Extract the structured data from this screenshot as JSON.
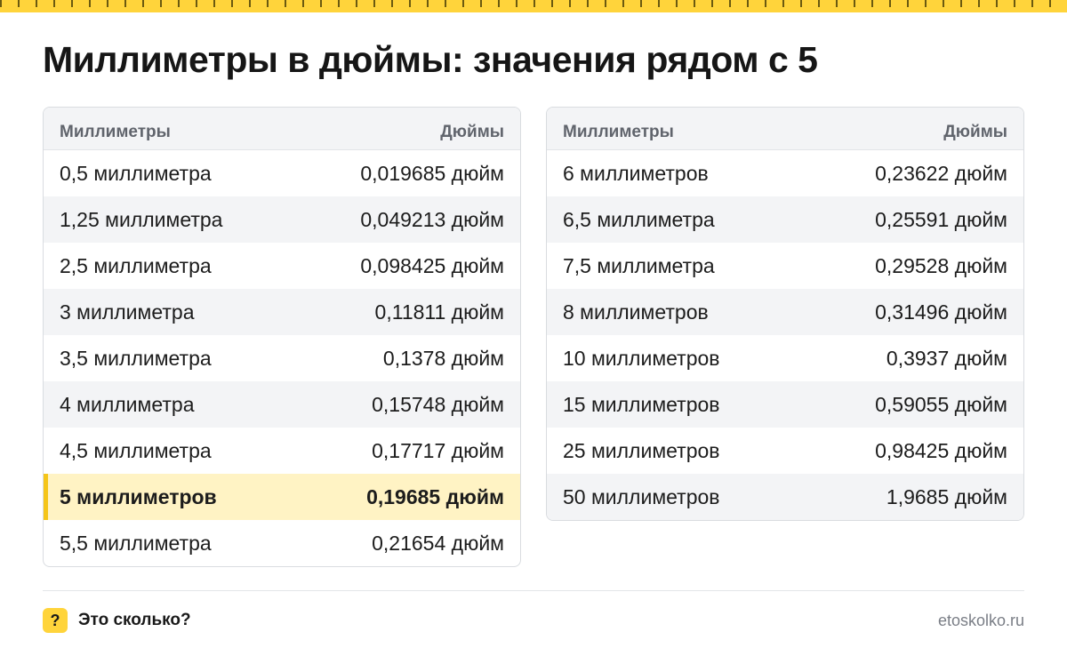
{
  "title": "Миллиметры в дюймы: значения рядом с 5",
  "colors": {
    "accent": "#ffd43b",
    "highlight_bg": "#fff3c4",
    "stripe": "#f3f4f6",
    "header_text": "#60646c"
  },
  "tables": {
    "left": {
      "headers": [
        "Миллиметры",
        "Дюймы"
      ],
      "rows": [
        {
          "mm": "0,5 миллиметра",
          "inch": "0,019685 дюйм"
        },
        {
          "mm": "1,25 миллиметра",
          "inch": "0,049213 дюйм"
        },
        {
          "mm": "2,5 миллиметра",
          "inch": "0,098425 дюйм"
        },
        {
          "mm": "3 миллиметра",
          "inch": "0,11811 дюйм"
        },
        {
          "mm": "3,5 миллиметра",
          "inch": "0,1378 дюйм"
        },
        {
          "mm": "4 миллиметра",
          "inch": "0,15748 дюйм"
        },
        {
          "mm": "4,5 миллиметра",
          "inch": "0,17717 дюйм"
        },
        {
          "mm": "5 миллиметров",
          "inch": "0,19685 дюйм",
          "highlight": true
        },
        {
          "mm": "5,5 миллиметра",
          "inch": "0,21654 дюйм"
        }
      ]
    },
    "right": {
      "headers": [
        "Миллиметры",
        "Дюймы"
      ],
      "rows": [
        {
          "mm": "6 миллиметров",
          "inch": "0,23622 дюйм"
        },
        {
          "mm": "6,5 миллиметра",
          "inch": "0,25591 дюйм"
        },
        {
          "mm": "7,5 миллиметра",
          "inch": "0,29528 дюйм"
        },
        {
          "mm": "8 миллиметров",
          "inch": "0,31496 дюйм"
        },
        {
          "mm": "10 миллиметров",
          "inch": "0,3937 дюйм"
        },
        {
          "mm": "15 миллиметров",
          "inch": "0,59055 дюйм"
        },
        {
          "mm": "25 миллиметров",
          "inch": "0,98425 дюйм"
        },
        {
          "mm": "50 миллиметров",
          "inch": "1,9685 дюйм"
        }
      ]
    }
  },
  "footer": {
    "badge_icon": "question-icon",
    "badge_symbol": "?",
    "brand": "Это сколько?",
    "site": "etoskolko.ru"
  }
}
